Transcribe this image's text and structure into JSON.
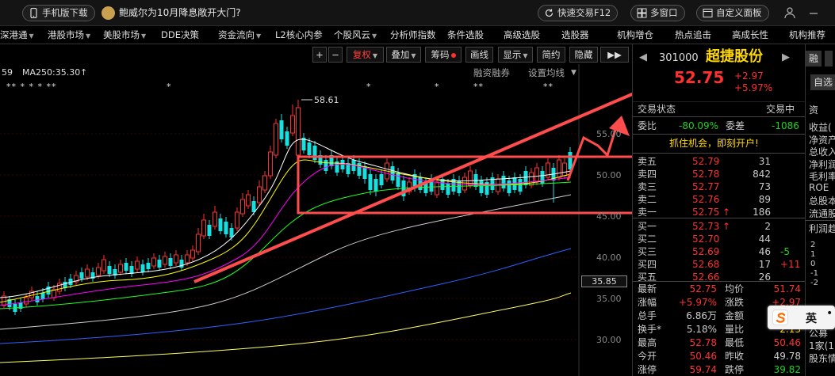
{
  "topbar": {
    "mobile_download": "手机版下载",
    "promo": "鲍威尔为10月降息敞开大门?",
    "quick_trade": "快速交易F12",
    "multi_window": "多窗口",
    "custom_panel": "自定义面板"
  },
  "menu": [
    {
      "label": "深港通",
      "caret": true
    },
    {
      "label": "港股市场",
      "caret": true
    },
    {
      "label": "美股市场",
      "caret": true
    },
    {
      "label": "DDE决策",
      "caret": false
    },
    {
      "label": "资金流向",
      "caret": true
    },
    {
      "label": "L2核心内参",
      "caret": false
    },
    {
      "label": "个股风云",
      "caret": true
    },
    {
      "label": "分析师指数",
      "caret": false
    },
    {
      "label": "条件选股",
      "caret": false
    },
    {
      "label": "高级选股",
      "caret": false
    },
    {
      "label": "选股器",
      "caret": false
    },
    {
      "label": "机构增仓",
      "caret": false
    },
    {
      "label": "热点追击",
      "caret": false
    },
    {
      "label": "高成长性",
      "caret": false
    },
    {
      "label": "机构推荐",
      "caret": false
    }
  ],
  "toolbar": {
    "plus": "+",
    "minus": "−",
    "fuquan": "复权",
    "diejia": "叠加",
    "chouma": "筹码",
    "huaxian": "画线",
    "xianshi": "显示",
    "jianyue": "简约",
    "yincang": "隐藏",
    "more": "▶▶"
  },
  "chart_header": {
    "ma_partial": "59",
    "ma250": "MA250:35.30",
    "margin_link": "融资融券",
    "ma_settings": "设置均线"
  },
  "chart_data": {
    "type": "candlestick",
    "price_labels": [
      "55.00",
      "50.00",
      "45.00",
      "40.00",
      "35.00",
      "30.00"
    ],
    "high_label": "58.61",
    "current_price_label": "35.85",
    "annotation_shapes": [
      "rectangle",
      "arrow"
    ],
    "annotation_color": "#ff4d4d"
  },
  "stock": {
    "code": "301000",
    "name": "超捷股份",
    "price": "52.75",
    "change": "+2.97",
    "change_pct": "+5.97%",
    "rong": "融",
    "zixuan": "自选"
  },
  "status": {
    "label": "交易状态",
    "value": "交易中"
  },
  "weibi": {
    "label": "委比",
    "value": "-80.09%",
    "diff_label": "委差",
    "diff_value": "-1086"
  },
  "promo_bar": "抓住机会，即刻开户!",
  "sells": [
    {
      "label": "卖五",
      "price": "52.79",
      "vol": "31",
      "chg": ""
    },
    {
      "label": "卖四",
      "price": "52.78",
      "vol": "842",
      "chg": ""
    },
    {
      "label": "卖三",
      "price": "52.77",
      "vol": "73",
      "chg": ""
    },
    {
      "label": "卖二",
      "price": "52.76",
      "vol": "89",
      "chg": ""
    },
    {
      "label": "卖一",
      "price": "52.75",
      "vol": "186",
      "chg": "↑"
    }
  ],
  "buys": [
    {
      "label": "买一",
      "price": "52.73",
      "vol": "2",
      "chg": "↑",
      "delta": ""
    },
    {
      "label": "买二",
      "price": "52.70",
      "vol": "44",
      "chg": "",
      "delta": ""
    },
    {
      "label": "买三",
      "price": "52.69",
      "vol": "46",
      "chg": "",
      "delta": "-5"
    },
    {
      "label": "买四",
      "price": "52.68",
      "vol": "17",
      "chg": "",
      "delta": "+11"
    },
    {
      "label": "买五",
      "price": "52.66",
      "vol": "26",
      "chg": "",
      "delta": ""
    }
  ],
  "stats": [
    {
      "l1": "最新",
      "v1": "52.75",
      "c1": "up",
      "l2": "均价",
      "v2": "51.74",
      "c2": "up"
    },
    {
      "l1": "涨幅",
      "v1": "+5.97%",
      "c1": "up",
      "l2": "涨跌",
      "v2": "+2.97",
      "c2": "up"
    },
    {
      "l1": "总手",
      "v1": "6.86万",
      "c1": "lbl",
      "l2": "金额",
      "v2": "",
      "c2": "lbl"
    },
    {
      "l1": "换手*",
      "v1": "5.18%",
      "c1": "lbl",
      "l2": "量比",
      "v2": "2.13",
      "c2": "yel"
    },
    {
      "l1": "最高",
      "v1": "52.78",
      "c1": "up",
      "l2": "最低",
      "v2": "50.46",
      "c2": "up"
    },
    {
      "l1": "今开",
      "v1": "50.46",
      "c1": "up",
      "l2": "昨收",
      "v2": "49.78",
      "c2": "lbl"
    },
    {
      "l1": "涨停",
      "v1": "59.74",
      "c1": "up",
      "l2": "跌停",
      "v2": "39.82",
      "c2": "dn"
    }
  ],
  "side2": {
    "tab": "资",
    "rows": [
      "收益(",
      "净资产",
      "总收入",
      "净利润",
      "毛利率",
      "ROE",
      "总股本",
      "流通股"
    ],
    "section": "利润趋",
    "axis": [
      "2",
      "1",
      "0",
      "-1",
      "-2"
    ],
    "bottom": [
      "公募",
      "1家(1",
      "股东情"
    ]
  },
  "ime": {
    "lang": "英"
  }
}
